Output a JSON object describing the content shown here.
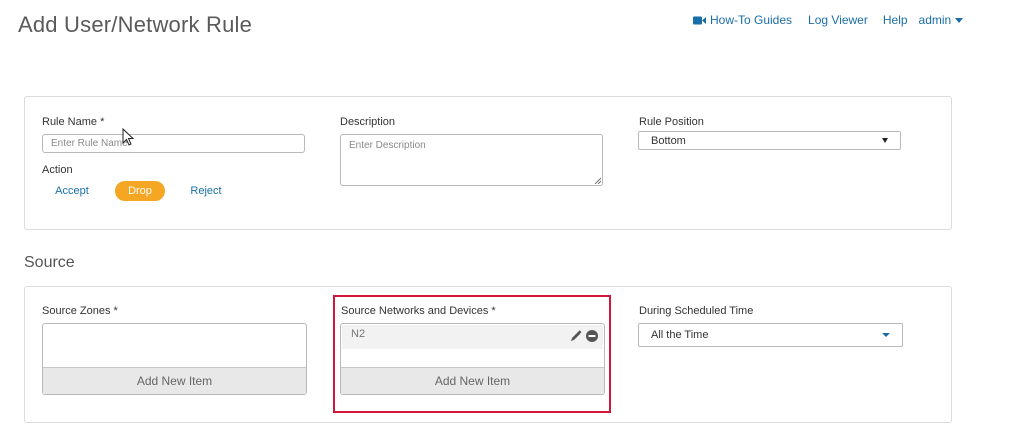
{
  "page": {
    "title": "Add User/Network Rule"
  },
  "topnav": {
    "howto_label": "How-To Guides",
    "logviewer_label": "Log Viewer",
    "help_label": "Help",
    "user_label": "admin"
  },
  "rule": {
    "name_label": "Rule Name *",
    "name_placeholder": "Enter Rule Name",
    "description_label": "Description",
    "description_placeholder": "Enter Description",
    "position_label": "Rule Position",
    "position_value": "Bottom",
    "action_label": "Action",
    "actions": [
      "Accept",
      "Drop",
      "Reject"
    ],
    "selected_action": "Drop"
  },
  "source": {
    "section_title": "Source",
    "zones_label": "Source Zones *",
    "zones_add_label": "Add New Item",
    "networks_label": "Source Networks and Devices *",
    "networks_items": [
      "N2"
    ],
    "networks_add_label": "Add New Item",
    "schedule_label": "During Scheduled Time",
    "schedule_value": "All the Time"
  },
  "colors": {
    "accent": "#1a6ea8",
    "selected_action": "#f5a623",
    "highlight": "#d0163b"
  },
  "icons": [
    "camera-icon",
    "chevron-down-icon",
    "pencil-icon",
    "remove-icon",
    "mouse-cursor-icon"
  ]
}
